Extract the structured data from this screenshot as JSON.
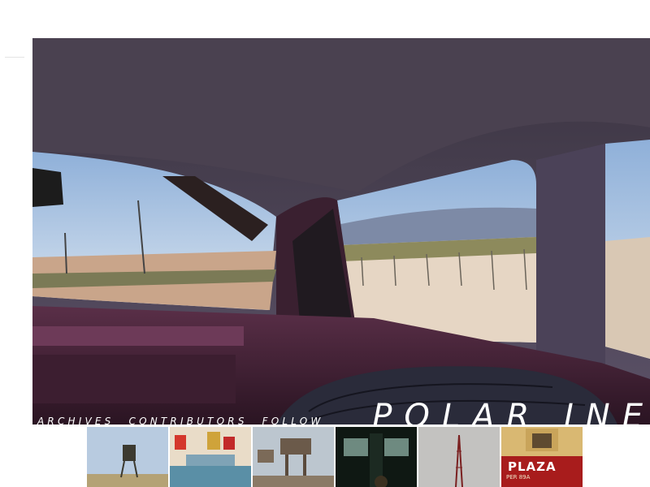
{
  "site": {
    "brand": "POLAR INE"
  },
  "nav": {
    "items": [
      "ARCHIVES",
      "CONTRIBUTORS",
      "FOLLOW"
    ]
  },
  "hero": {
    "icon": "car-window-photo"
  },
  "thumbnails": [
    {
      "icon": "watchtower-photo"
    },
    {
      "icon": "shop-interior-photo"
    },
    {
      "icon": "rusted-tower-photo"
    },
    {
      "icon": "doorway-photo"
    },
    {
      "icon": "radio-mast-photo"
    },
    {
      "icon": "plaza-sign-photo",
      "sign_text": "PLAZA",
      "sign_subtext": "PER 89A"
    }
  ]
}
